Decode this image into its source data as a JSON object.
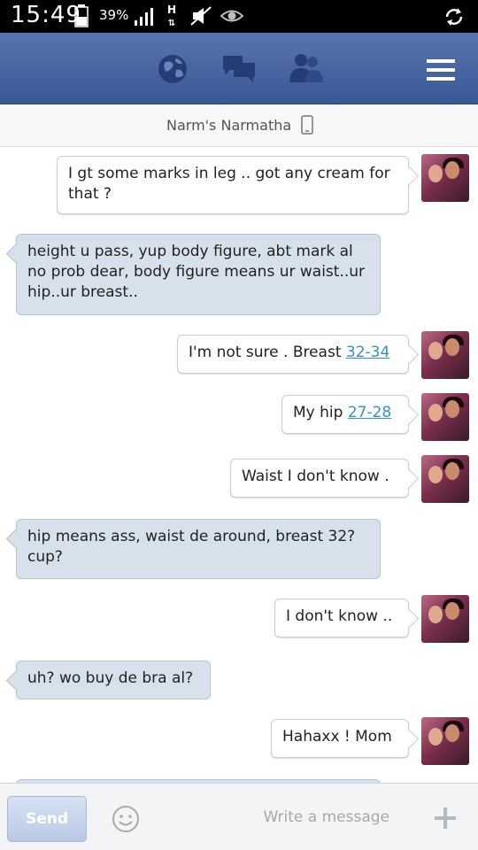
{
  "status_bar": {
    "time": "15:49",
    "battery_percent": "39%",
    "network": "H"
  },
  "header": {
    "icons": [
      "globe-icon",
      "chat-icon",
      "friends-icon",
      "menu-icon"
    ]
  },
  "conversation": {
    "contact_name": "Narm's Narmatha"
  },
  "messages": [
    {
      "from": "me",
      "text": "I gt some marks in leg .. got any cream for that ?"
    },
    {
      "from": "them",
      "text": "height u pass, yup body figure, abt mark al no prob dear, body figure means ur waist..ur hip..ur breast.."
    },
    {
      "from": "me",
      "text": "I'm not sure . Breast ",
      "link": "32-34"
    },
    {
      "from": "me",
      "text": "My hip ",
      "link": "27-28"
    },
    {
      "from": "me",
      "text": "Waist I don't know ."
    },
    {
      "from": "them",
      "text": "hip means ass, waist de around, breast 32? cup?"
    },
    {
      "from": "me",
      "text": "I don't know .."
    },
    {
      "from": "them",
      "text": "uh? wo buy de bra al?"
    },
    {
      "from": "me",
      "text": "Hahaxx ! Mom"
    }
  ],
  "compose": {
    "placeholder": "Write a message",
    "send_label": "Send"
  },
  "colors": {
    "header_blue": "#3a5896",
    "incoming_bubble": "#d7e1ec",
    "link": "#3b8fc0"
  }
}
